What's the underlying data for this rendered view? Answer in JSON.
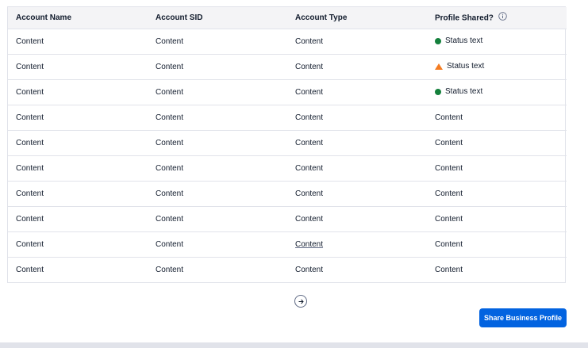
{
  "table": {
    "headers": [
      "Account Name",
      "Account SID",
      "Account Type",
      "Profile Shared?"
    ],
    "rows": [
      [
        "Content",
        "Content",
        "Content",
        "Status text"
      ],
      [
        "Content",
        "Content",
        "Content",
        "Status text"
      ],
      [
        "Content",
        "Content",
        "Content",
        "Status text"
      ],
      [
        "Content",
        "Content",
        "Content",
        "Content"
      ],
      [
        "Content",
        "Content",
        "Content",
        "Content"
      ],
      [
        "Content",
        "Content",
        "Content",
        "Content"
      ],
      [
        "Content",
        "Content",
        "Content",
        "Content"
      ],
      [
        "Content",
        "Content",
        "Content",
        "Content"
      ],
      [
        "Content",
        "Content",
        "Content",
        "Content"
      ],
      [
        "Content",
        "Content",
        "Content",
        "Content"
      ]
    ],
    "status_icons": [
      "success-dot",
      "warning-triangle",
      "success-dot"
    ]
  },
  "colors": {
    "success": "#14803c",
    "warning": "#f47c22",
    "primary": "#0263e0"
  },
  "actions": {
    "share_label": "Share Business Profile",
    "next_page_icon": "arrow-right-icon"
  }
}
